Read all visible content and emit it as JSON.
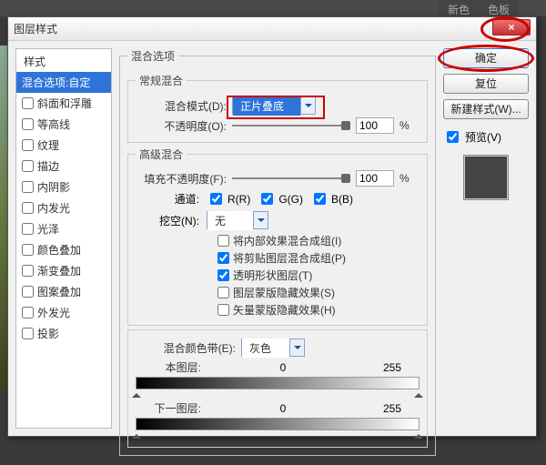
{
  "bg_tabs": {
    "a": "新色",
    "b": "色板"
  },
  "dialog": {
    "title": "图层样式",
    "close_glyph": "×",
    "styles": {
      "header": "样式",
      "selected": "混合选项:自定",
      "items": [
        "斜面和浮雕",
        "等高线",
        "纹理",
        "描边",
        "内阴影",
        "内发光",
        "光泽",
        "颜色叠加",
        "渐变叠加",
        "图案叠加",
        "外发光",
        "投影"
      ]
    },
    "blend": {
      "group_title": "混合选项",
      "general": {
        "title": "常规混合",
        "mode_label": "混合模式(D):",
        "mode_value": "正片叠底",
        "opacity_label": "不透明度(O):",
        "opacity_value": "100",
        "pct": "%"
      },
      "advanced": {
        "title": "高级混合",
        "fill_label": "填充不透明度(F):",
        "fill_value": "100",
        "pct": "%",
        "channels_label": "通道:",
        "r": "R(R)",
        "g": "G(G)",
        "b": "B(B)",
        "knockout_label": "挖空(N):",
        "knockout_value": "无",
        "opts": [
          "将内部效果混合成组(I)",
          "将剪贴图层混合成组(P)",
          "透明形状图层(T)",
          "图层蒙版隐藏效果(S)",
          "矢量蒙版隐藏效果(H)"
        ],
        "opts_checked": [
          false,
          true,
          true,
          false,
          false
        ]
      },
      "blendif": {
        "label": "混合颜色带(E):",
        "value": "灰色",
        "this_label": "本图层:",
        "under_label": "下一图层:",
        "min": "0",
        "max": "255"
      }
    },
    "buttons": {
      "ok": "确定",
      "cancel": "复位",
      "newstyle": "新建样式(W)...",
      "preview": "预览(V)"
    }
  }
}
